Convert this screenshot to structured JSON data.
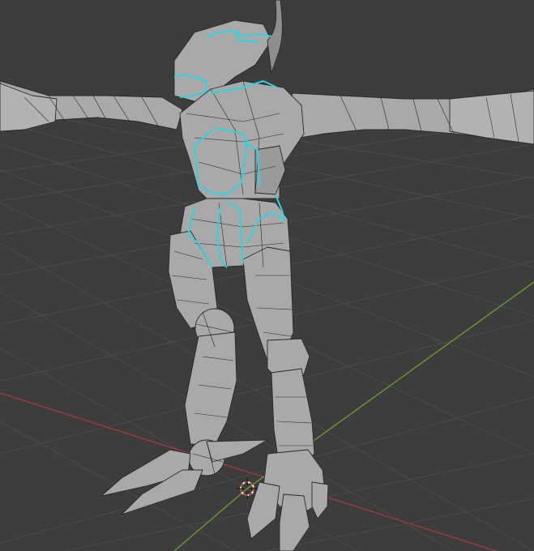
{
  "viewport": {
    "mode": "3D Viewport",
    "overlay": "wireframe",
    "object": "robot-creature-mesh",
    "selection": "seam-edges"
  },
  "colors": {
    "background": "#3d3d3d",
    "grid": "#4a4a4a",
    "x_axis": "#9b3a42",
    "y_axis": "#6a9a2a",
    "mesh_fill": "#a9a9a9",
    "mesh_wire": "#2a2a2a",
    "selected_edges": "#2fd3e0",
    "cursor_outer": "#d24a3a",
    "cursor_inner": "#f0f0f0"
  },
  "icons": {
    "cursor": "3d-cursor-icon"
  }
}
